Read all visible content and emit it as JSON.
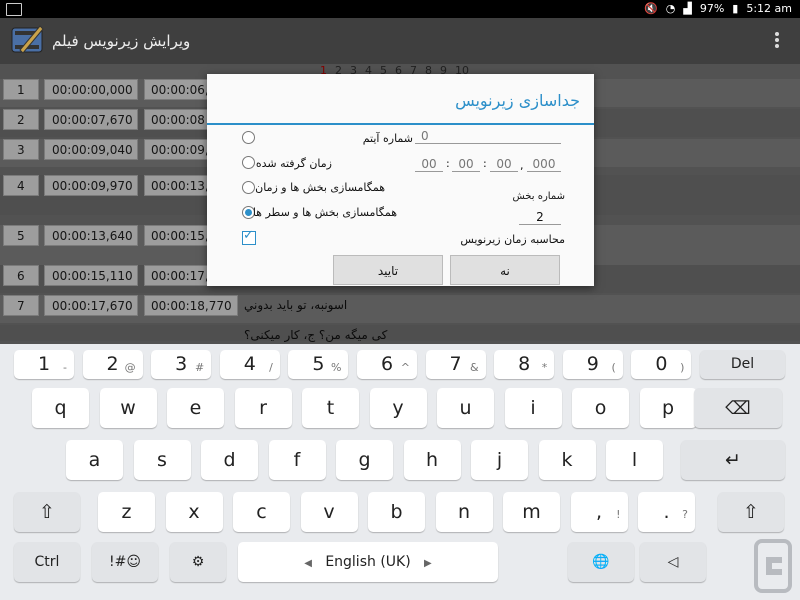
{
  "status_bar": {
    "battery": "97%",
    "time": "5:12 am"
  },
  "app_bar": {
    "title": "ویرایش زیرنویس فیلم"
  },
  "pages": [
    "1",
    "2",
    "3",
    "4",
    "5",
    "6",
    "7",
    "8",
    "9",
    "10"
  ],
  "rows": [
    {
      "num": "1",
      "start": "00:00:00,000",
      "end": "00:00:06,",
      "text": ""
    },
    {
      "num": "2",
      "start": "00:00:07,670",
      "end": "00:00:08",
      "text": ""
    },
    {
      "num": "3",
      "start": "00:00:09,040",
      "end": "00:00:09,",
      "text": ""
    },
    {
      "num": "4",
      "start": "00:00:09,970",
      "end": "00:00:13,",
      "text": ""
    },
    {
      "num": "5",
      "start": "00:00:13,640",
      "end": "00:00:15,",
      "text": ""
    },
    {
      "num": "6",
      "start": "00:00:15,110",
      "end": "00:00:17,",
      "text": ""
    },
    {
      "num": "7",
      "start": "00:00:17,670",
      "end": "00:00:18,770",
      "text": "اسونبه، تو باید بدوني"
    },
    {
      "num": "",
      "start": "",
      "end": "",
      "text": "کی میگه من؟ ج، کار میکنی؟"
    }
  ],
  "dialog": {
    "title": "جداسازی زیرنویس",
    "options": [
      {
        "label": "شماره آیتم",
        "selected": false
      },
      {
        "label": "زمان گرفته شده",
        "selected": false
      },
      {
        "label": "همگامسازی بخش ها و زمان",
        "selected": false
      },
      {
        "label": "همگامسازی بخش ها و سطر ها",
        "selected": true
      }
    ],
    "item_number_value": "0",
    "time_fields": {
      "hh": "00",
      "mm": "00",
      "ss": "00",
      "ms": "000"
    },
    "section_number_label": "شماره بخش",
    "section_number_value": "2",
    "calc_time_label": "محاسبه زمان زیرنویس",
    "calc_time_checked": true,
    "confirm_label": "تایید",
    "no_label": "نه"
  },
  "keyboard": {
    "number_row": [
      {
        "main": "1",
        "sub": "-"
      },
      {
        "main": "2",
        "sub": "@"
      },
      {
        "main": "3",
        "sub": "#"
      },
      {
        "main": "4",
        "sub": "/"
      },
      {
        "main": "5",
        "sub": "%"
      },
      {
        "main": "6",
        "sub": "^"
      },
      {
        "main": "7",
        "sub": "&"
      },
      {
        "main": "8",
        "sub": "*"
      },
      {
        "main": "9",
        "sub": "("
      },
      {
        "main": "0",
        "sub": ")"
      }
    ],
    "del_label": "Del",
    "row1": [
      "q",
      "w",
      "e",
      "r",
      "t",
      "y",
      "u",
      "i",
      "o",
      "p"
    ],
    "row2": [
      "a",
      "s",
      "d",
      "f",
      "g",
      "h",
      "j",
      "k",
      "l"
    ],
    "row3": [
      "z",
      "x",
      "c",
      "v",
      "b",
      "n",
      "m",
      ",",
      "."
    ],
    "row3_subs": {
      ",": "!",
      ".": "?"
    },
    "ctrl_label": "Ctrl",
    "sym_label": "!#☺",
    "language_label": "English (UK)"
  }
}
